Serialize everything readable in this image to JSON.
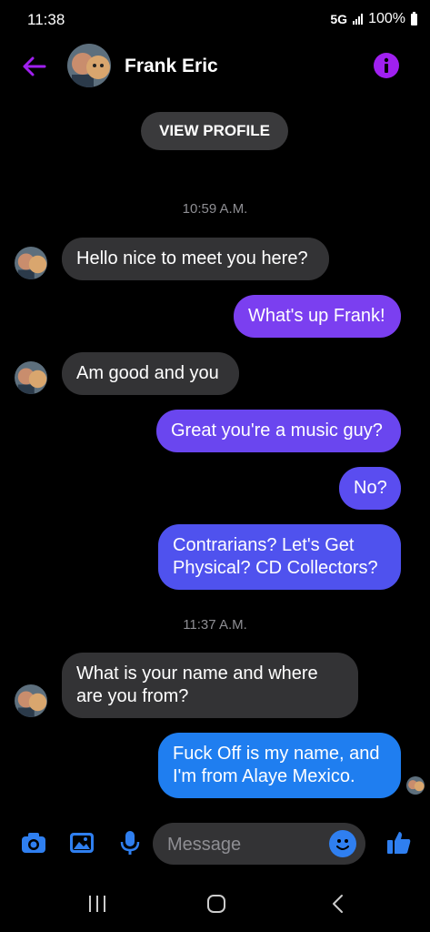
{
  "status_bar": {
    "time": "11:38",
    "network": "5G",
    "battery": "100%"
  },
  "header": {
    "contact_name": "Frank Eric",
    "view_profile_label": "VIEW PROFILE"
  },
  "messages": [
    {
      "type": "timestamp",
      "text": "10:59 A.M."
    },
    {
      "type": "incoming",
      "text": "Hello nice to meet you here?"
    },
    {
      "type": "outgoing",
      "text": "What's up Frank!"
    },
    {
      "type": "incoming",
      "text": "Am good and you"
    },
    {
      "type": "outgoing",
      "text": "Great you're a music guy?"
    },
    {
      "type": "outgoing",
      "text": "No?"
    },
    {
      "type": "outgoing",
      "text": "Contrarians?  Let's Get\nPhysical?  CD Collectors?"
    },
    {
      "type": "timestamp",
      "text": "11:37 A.M."
    },
    {
      "type": "incoming",
      "text": "What is your name and where\nare you from?"
    },
    {
      "type": "outgoing",
      "text": "Fuck Off is my name, and\nI'm from Alaye Mexico."
    }
  ],
  "composer": {
    "placeholder": "Message"
  },
  "colors": {
    "accent_purple": "#a020f0",
    "bubble_violet": "#7b3ff0",
    "bubble_indigo": "#4f52ee",
    "bubble_blue": "#1f7ef0",
    "icon_blue": "#2f7ff0",
    "incoming_bubble": "#333335"
  },
  "icons": [
    "back-arrow-icon",
    "info-icon",
    "camera-icon",
    "gallery-icon",
    "microphone-icon",
    "emoji-icon",
    "thumbs-up-icon",
    "recent-apps-icon",
    "home-icon",
    "back-icon"
  ]
}
